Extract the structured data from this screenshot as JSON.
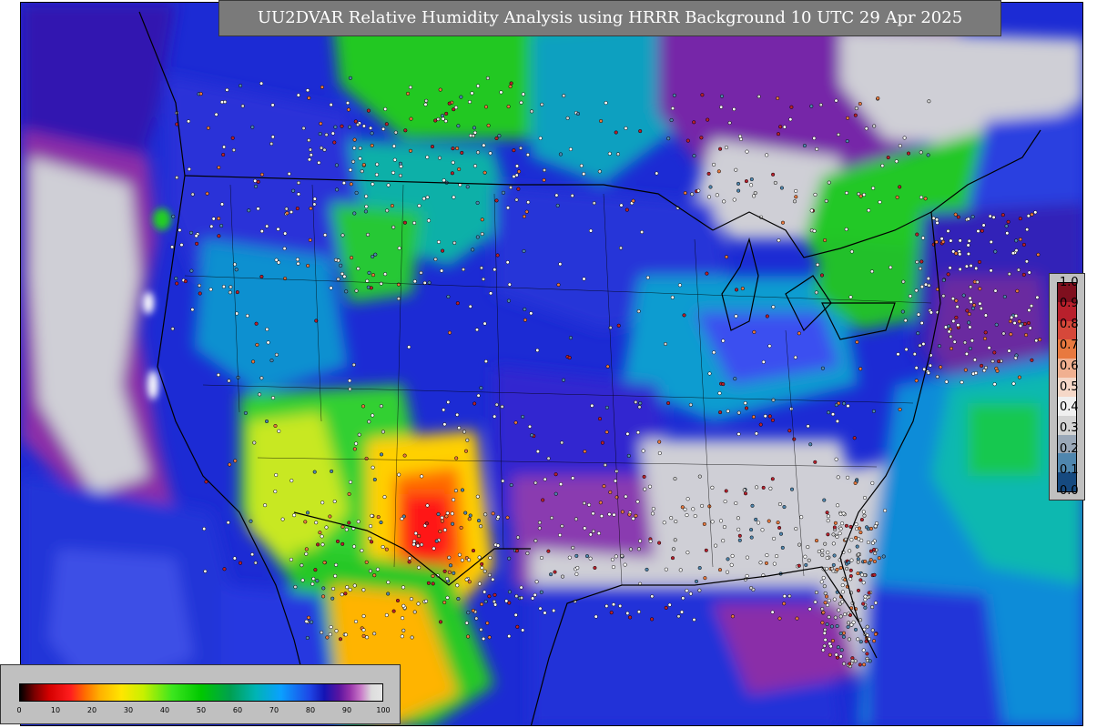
{
  "map": {
    "title": "UU2DVAR Relative Humidity Analysis using HRRR Background 10 UTC 29 Apr 2025",
    "projection_region": "CONUS",
    "background_color": "#1a2fd6"
  },
  "rh_colorbar": {
    "ticks": [
      "0",
      "10",
      "20",
      "30",
      "40",
      "50",
      "60",
      "70",
      "80",
      "90",
      "100"
    ],
    "min": 0,
    "max": 100
  },
  "obs_colorbar": {
    "ticks": [
      "1.0",
      "0.9",
      "0.8",
      "0.7",
      "0.6",
      "0.5",
      "0.4",
      "0.3",
      "0.2",
      "0.1",
      "0.0"
    ],
    "colors": [
      "#7f0f1e",
      "#b8202c",
      "#d6483a",
      "#e8793f",
      "#f0b090",
      "#f5d8c8",
      "#f0f0f0",
      "#d4d4d4",
      "#9aa8b8",
      "#4f86ae",
      "#164a80"
    ]
  },
  "icons": {
    "station_marker": "station-dot-icon"
  }
}
